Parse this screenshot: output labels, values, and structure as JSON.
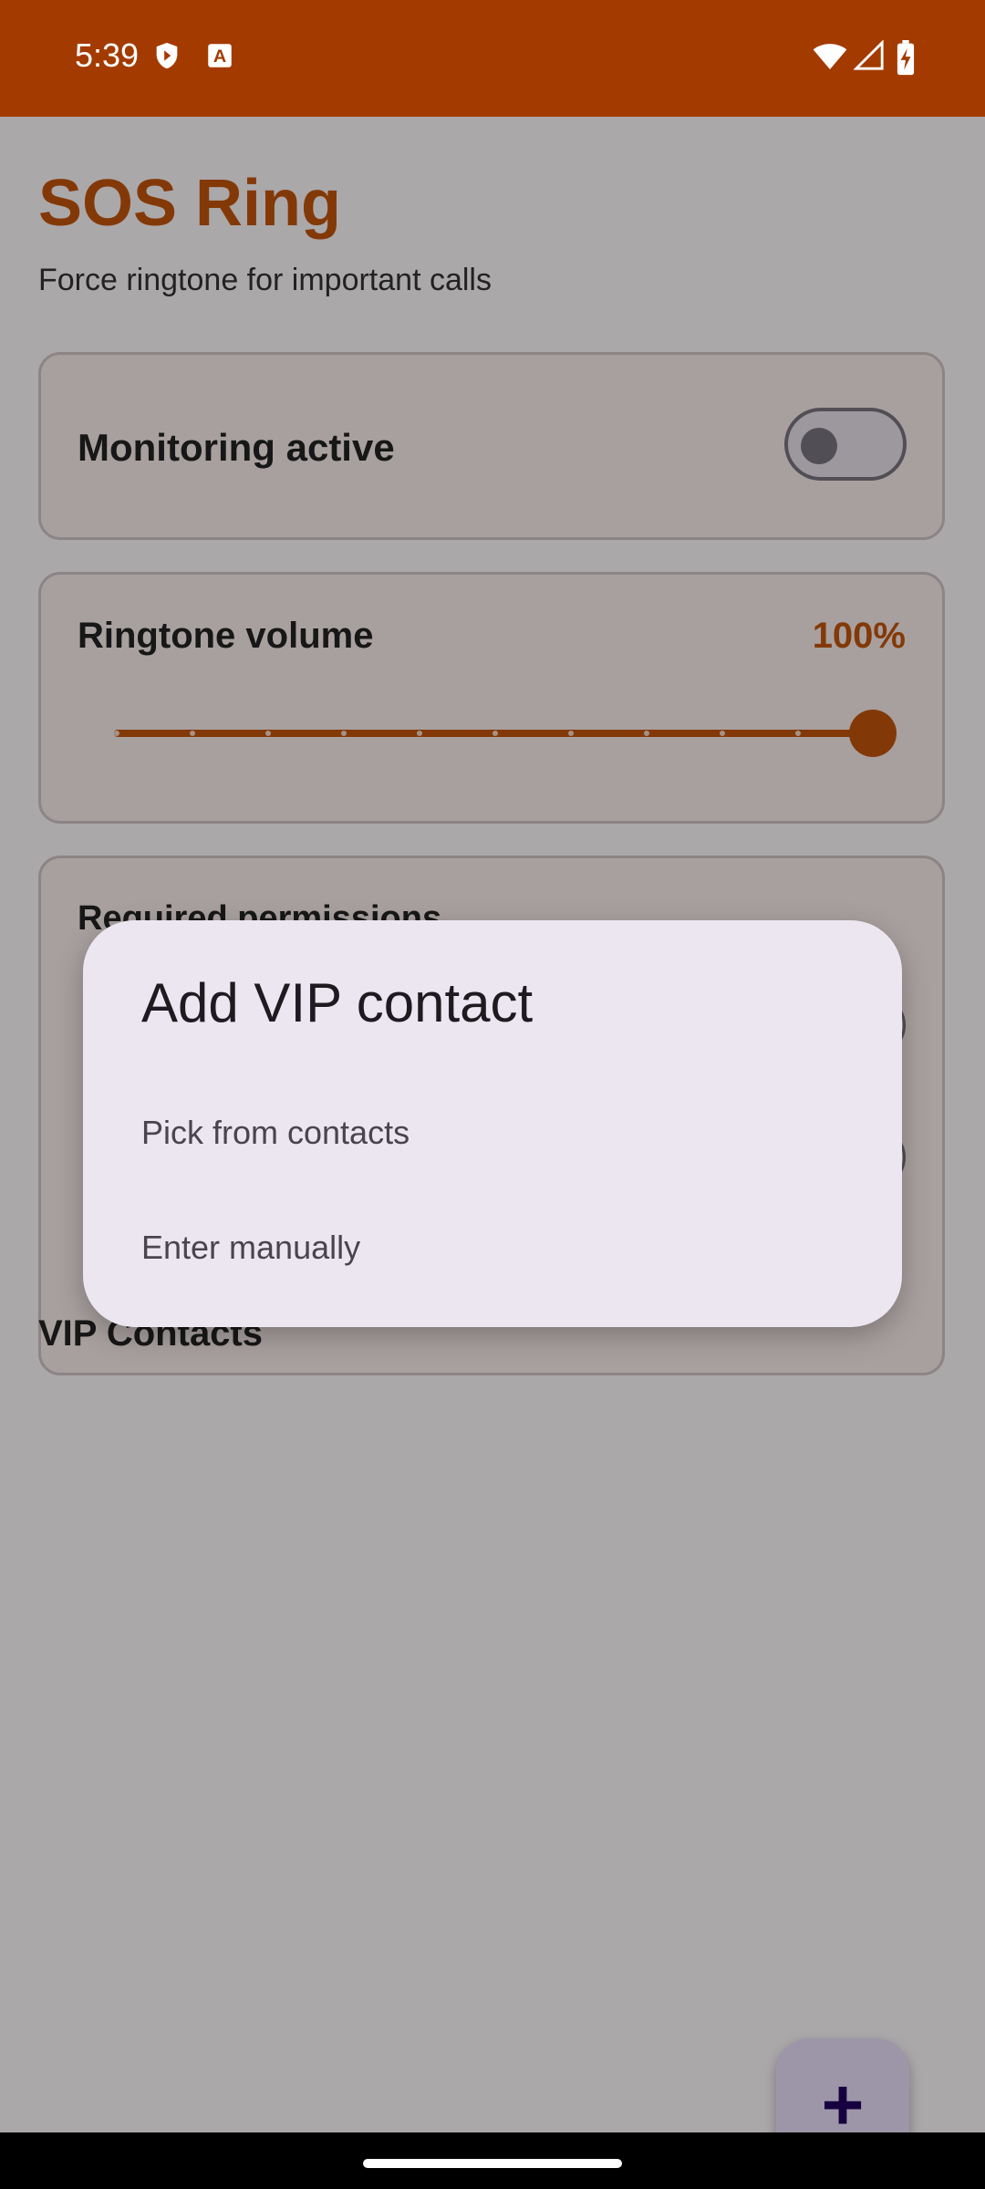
{
  "status_bar": {
    "time": "5:39",
    "left_icons": [
      "play-shield-icon",
      "a-box-icon"
    ],
    "right_icons": [
      "wifi-icon",
      "signal-icon",
      "battery-charging-icon"
    ]
  },
  "app": {
    "title": "SOS Ring",
    "subtitle": "Force ringtone for important calls",
    "monitoring": {
      "label": "Monitoring active",
      "enabled": false
    },
    "volume": {
      "label": "Ringtone volume",
      "value_text": "100%",
      "value": 1.0
    },
    "permissions": {
      "heading": "Required permissions"
    },
    "vip_section": {
      "title": "VIP Contacts"
    },
    "fab_icon": "plus-icon",
    "accent_color": "#c2540b"
  },
  "dialog": {
    "title": "Add VIP contact",
    "options": [
      "Pick from contacts",
      "Enter manually"
    ]
  }
}
